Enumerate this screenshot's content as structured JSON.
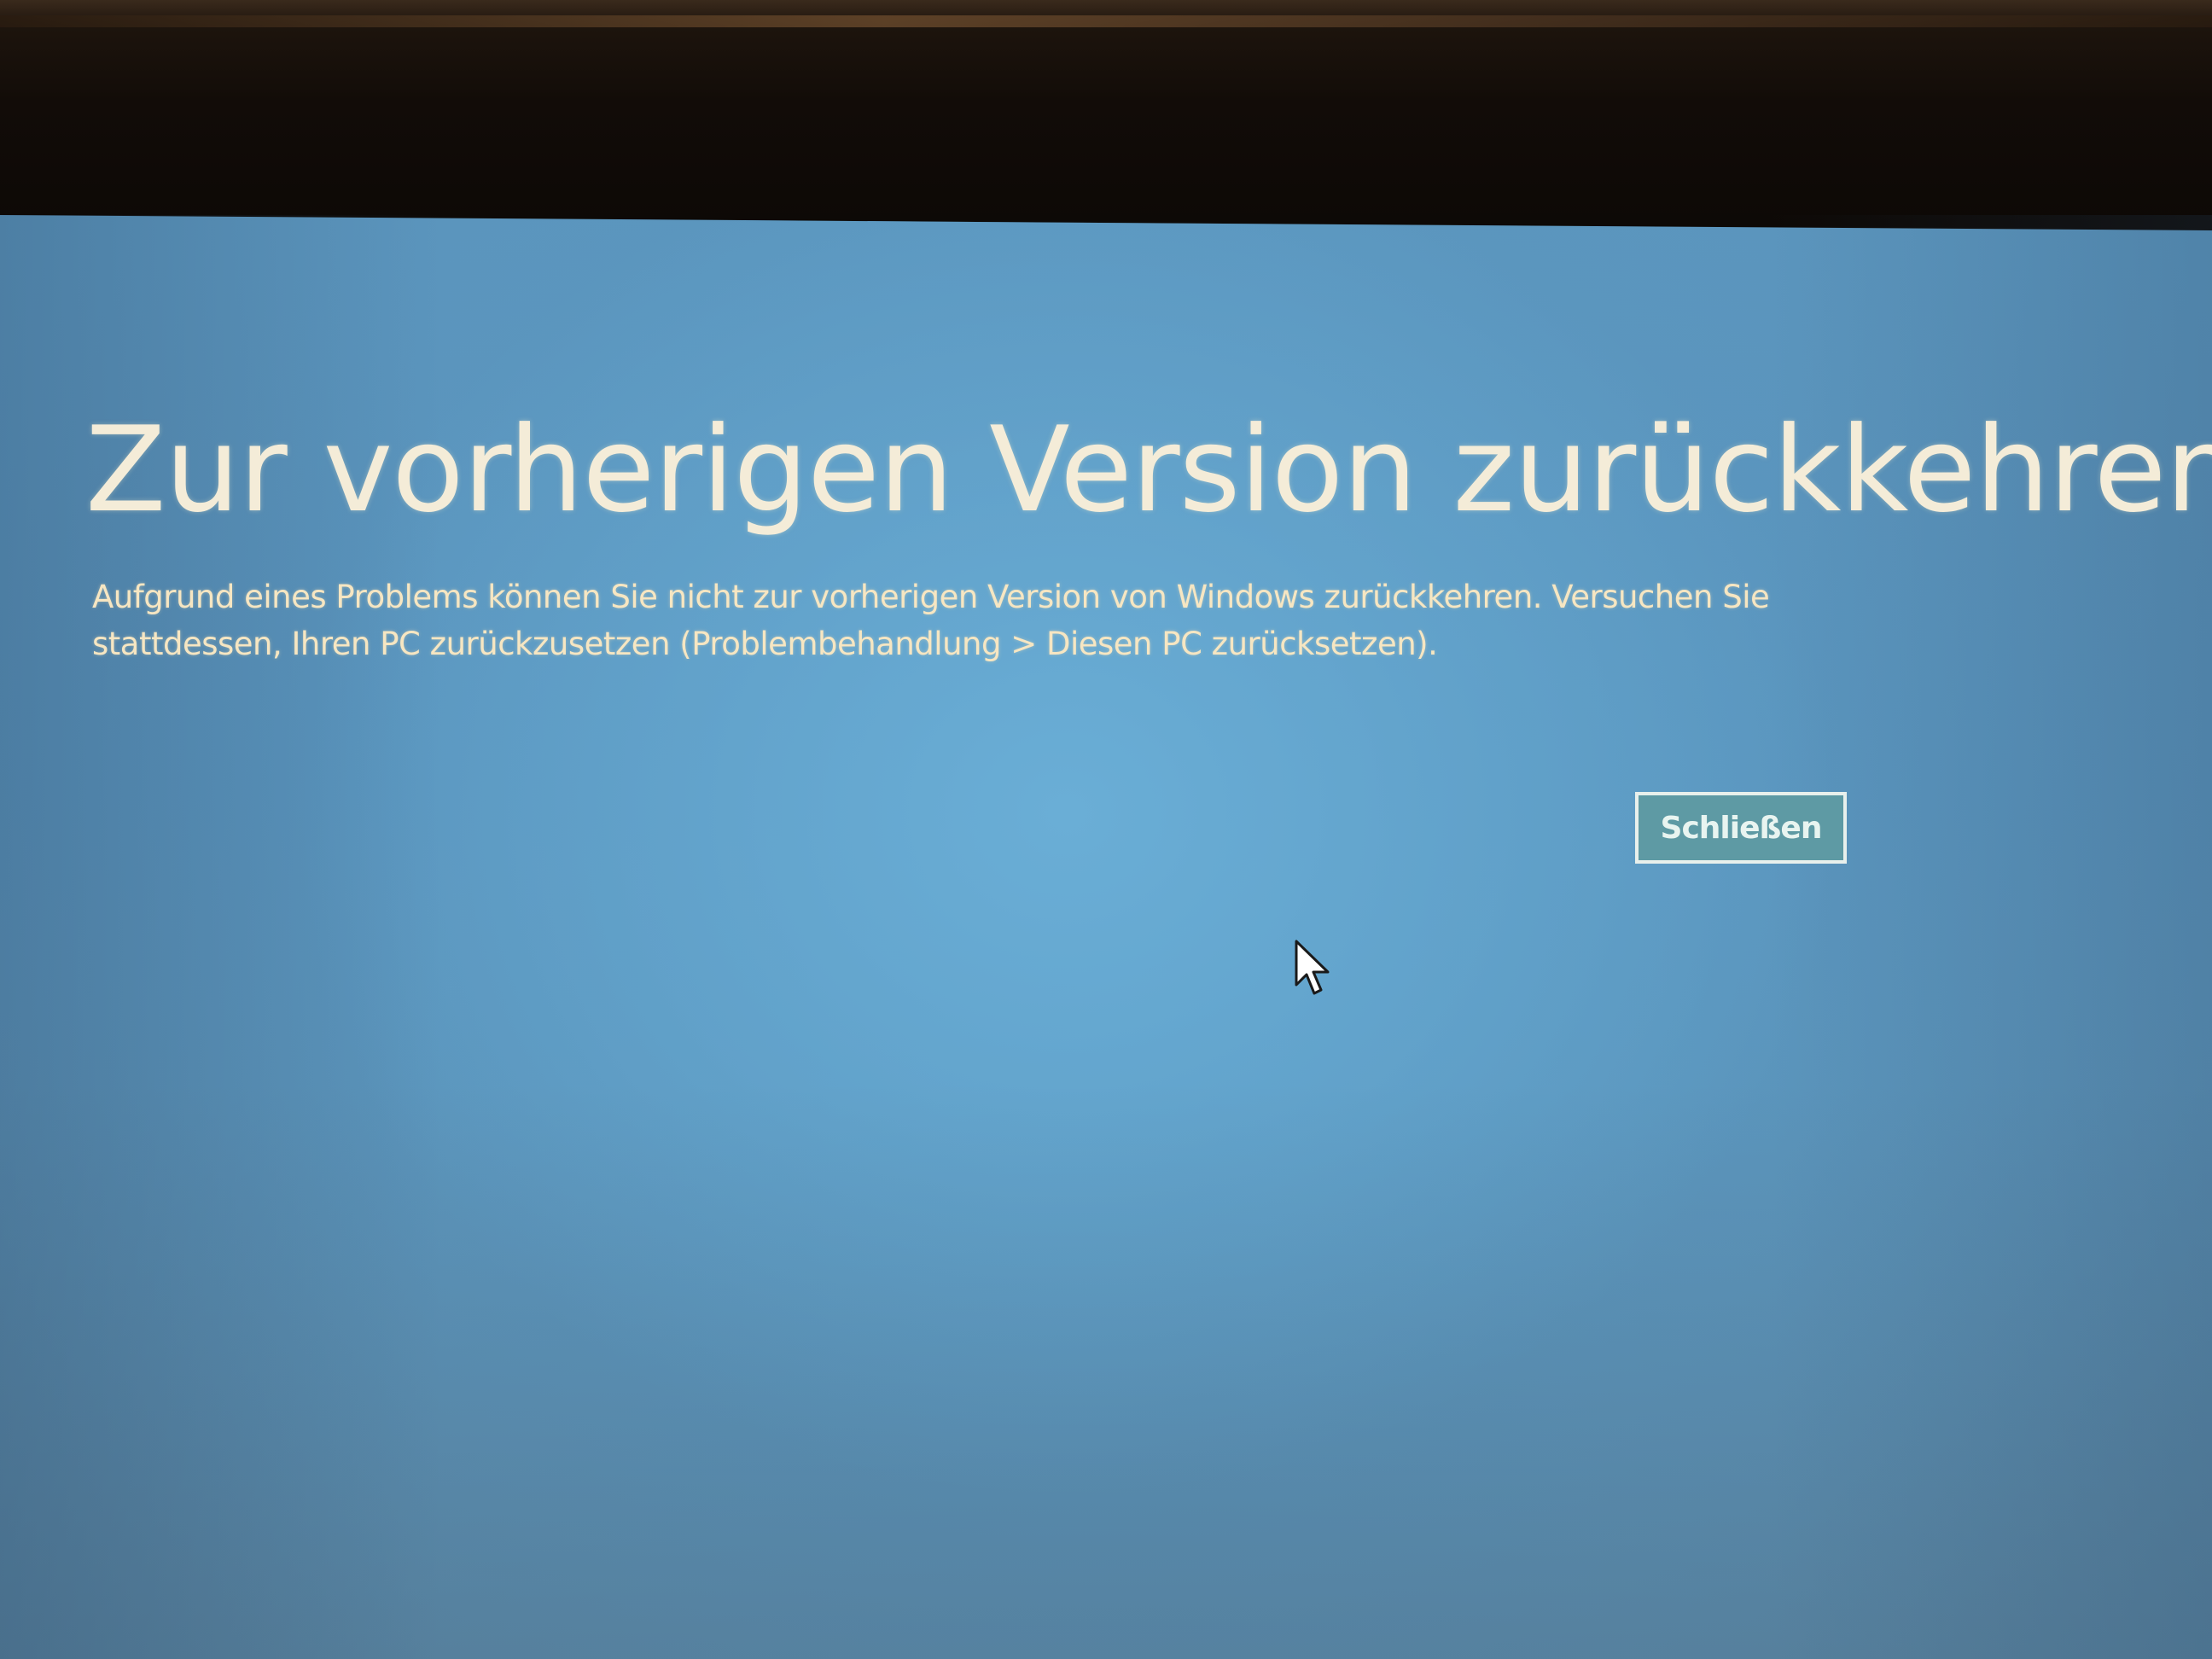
{
  "dialog": {
    "title": "Zur vorherigen Version zurückkehren",
    "message": "Aufgrund eines Problems können Sie nicht zur vorherigen Version von Windows zurückkehren. Versuchen Sie stattdessen, Ihren PC zurückzusetzen (Problembehandlung > Diesen PC zurücksetzen).",
    "close_label": "Schließen"
  },
  "colors": {
    "screen_background": "#5b95bd",
    "text": "#f4ecd8",
    "button_background": "#5e9aa4",
    "button_border": "#e8f0ec"
  },
  "icons": {
    "cursor": "mouse-pointer-icon"
  }
}
